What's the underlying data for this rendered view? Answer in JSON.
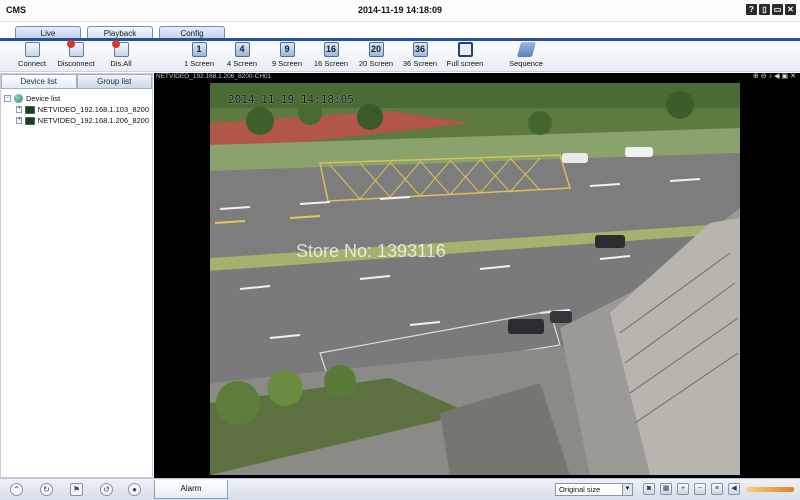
{
  "titlebar": {
    "app_title": "CMS",
    "datetime": "2014-11-19 14:18:09",
    "buttons": [
      "?",
      "▯",
      "▭",
      "✕"
    ]
  },
  "tabs": [
    {
      "label": "Live",
      "active": false
    },
    {
      "label": "Playback",
      "active": true
    },
    {
      "label": "Config",
      "active": false
    }
  ],
  "toolbar": {
    "connect": "Connect",
    "disconnect": "Disconnect",
    "dis_all": "Dis.All",
    "screen1": "1 Screen",
    "screen4": "4 Screen",
    "screen9": "9 Screen",
    "screen16": "16 Screen",
    "screen20": "20 Screen",
    "screen36": "36 Screen",
    "full_screen": "Full screen",
    "sequence": "Sequence",
    "screen_nums": {
      "s1": "1",
      "s4": "4",
      "s9": "9",
      "s16": "16",
      "s20": "20",
      "s36": "36"
    }
  },
  "left_panel": {
    "tab_device": "Device list",
    "tab_group": "Group list",
    "root": "Device list",
    "devices": [
      "NETVIDEO_192.168.1.103_8200",
      "NETVIDEO_192.168.1.206_8200"
    ]
  },
  "video": {
    "channel_label": "NETVIDEO_192.168.1.206_8200-CH01",
    "osd_time": "2014-11-19 14:18:05",
    "watermark": "Store No: 1393116"
  },
  "bottom": {
    "alarm": "Alarm",
    "size_select": "Original size"
  },
  "colors": {
    "accent_blue": "#27519a",
    "volume": "#e87f1e"
  }
}
